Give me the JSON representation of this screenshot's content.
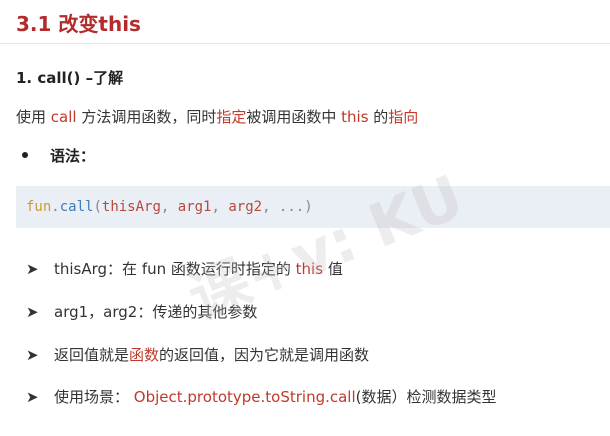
{
  "title": "3.1 改变this",
  "subtitle": "1. call() –了解",
  "desc": {
    "p1": "使用 ",
    "call": "call",
    "p2": " 方法调用函数，同时",
    "specify": "指定",
    "p3": "被调用函数中 ",
    "this": "this",
    "p4": " 的",
    "pointing": "指向"
  },
  "syntax_label": "语法：",
  "code": {
    "fun": "fun",
    "dot": ".",
    "call": "call",
    "open": "(",
    "arg0": "thisArg",
    "sep1": ", ",
    "arg1": "arg1",
    "sep2": ", ",
    "arg2": "arg2",
    "sep3": ", ",
    "rest": "...",
    "close": ")"
  },
  "items": [
    {
      "a": "thisArg：在 fun 函数运行时指定的 ",
      "red": "this",
      "b": " 值"
    },
    {
      "a": "arg1，arg2：传递的其他参数",
      "red": "",
      "b": ""
    },
    {
      "a": "返回值就是",
      "red": "函数",
      "b": "的返回值，因为它就是调用函数"
    },
    {
      "a": "使用场景：  ",
      "red": "Object.prototype.toString.call",
      "b": "(数据）检测数据类型"
    }
  ],
  "arrow": "➤",
  "watermark": "课+v: KU"
}
